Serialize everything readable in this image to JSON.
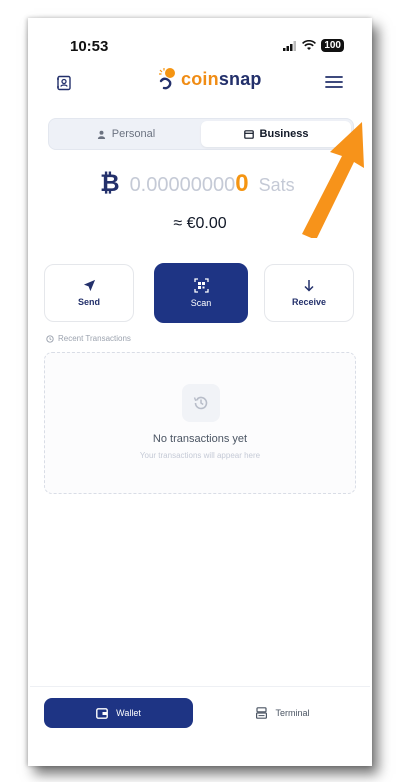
{
  "status_bar": {
    "time": "10:53",
    "battery": "100"
  },
  "header": {
    "logo_coin": "coin",
    "logo_snap": "snap"
  },
  "tabs": [
    {
      "label": "Personal",
      "active": false
    },
    {
      "label": "Business",
      "active": true
    }
  ],
  "balance": {
    "zeros": "0.00000000",
    "nonzero": "0",
    "unit": "Sats",
    "fiat": "≈ €0.00"
  },
  "actions": {
    "send": "Send",
    "scan": "Scan",
    "receive": "Receive"
  },
  "recent": {
    "label": "Recent Transactions",
    "empty_title": "No transactions yet",
    "empty_subtitle": "Your transactions will appear here"
  },
  "bottom_nav": {
    "wallet": "Wallet",
    "terminal": "Terminal"
  },
  "colors": {
    "brand_navy": "#1e3484",
    "brand_orange": "#f08c14",
    "annotation_arrow": "#f7931a"
  },
  "icons": [
    "contacts-icon",
    "logo-icon",
    "menu-icon",
    "person-icon",
    "store-icon",
    "bitcoin-icon",
    "send-icon",
    "scan-qr-icon",
    "receive-icon",
    "history-icon",
    "wallet-icon",
    "terminal-icon"
  ]
}
